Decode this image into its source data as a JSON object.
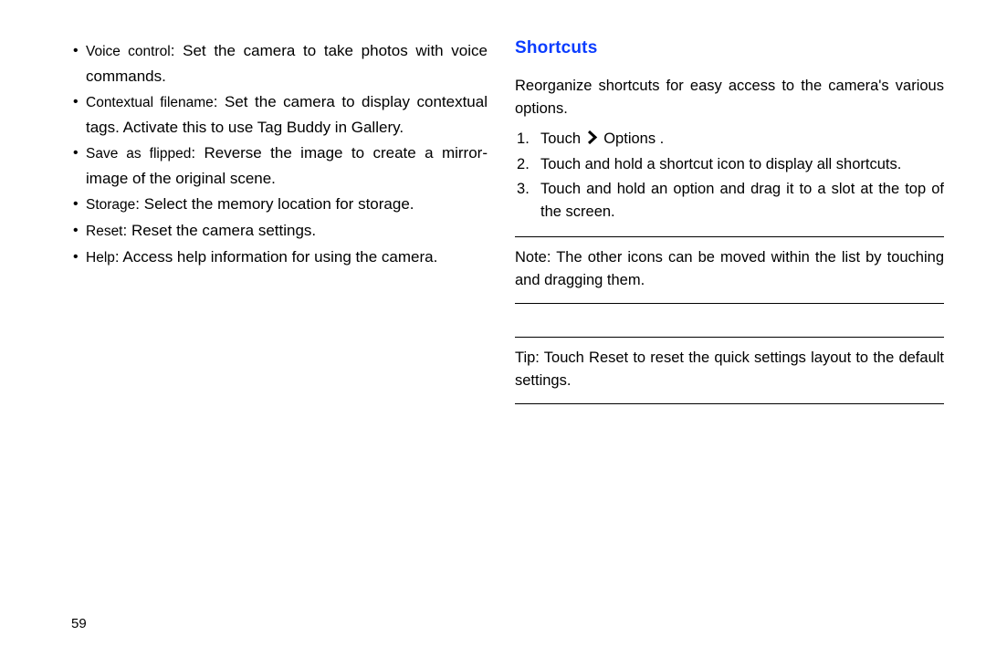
{
  "left": {
    "items": [
      {
        "term": "Voice control",
        "desc": ": Set the camera to take photos with voice commands."
      },
      {
        "term": "Contextual filename",
        "desc": ": Set the camera to display contextual tags. Activate this to use Tag Buddy in Gallery."
      },
      {
        "term": "Save as flipped",
        "desc": ": Reverse the image to create a mirror-image of the original scene."
      },
      {
        "term": "Storage",
        "desc": ": Select the memory location for storage."
      },
      {
        "term": "Reset",
        "desc": ": Reset the camera settings."
      },
      {
        "term": "Help",
        "desc": ": Access help information for using the camera."
      }
    ]
  },
  "right": {
    "heading": "Shortcuts",
    "intro": "Reorganize shortcuts for easy access to the camera's various options.",
    "steps": {
      "s1a": "Touch",
      "s1b": "Options .",
      "s2": "Touch and hold a shortcut icon to display all shortcuts.",
      "s3": "Touch and hold an option and drag it to a slot at the top of the screen."
    },
    "note_label": "Note:",
    "note_text": " The other icons can be moved within the list by touching and dragging them.",
    "tip_label": "Tip:",
    "tip_text": " Touch Reset to reset the quick settings layout to the default settings."
  },
  "page_number": "59"
}
